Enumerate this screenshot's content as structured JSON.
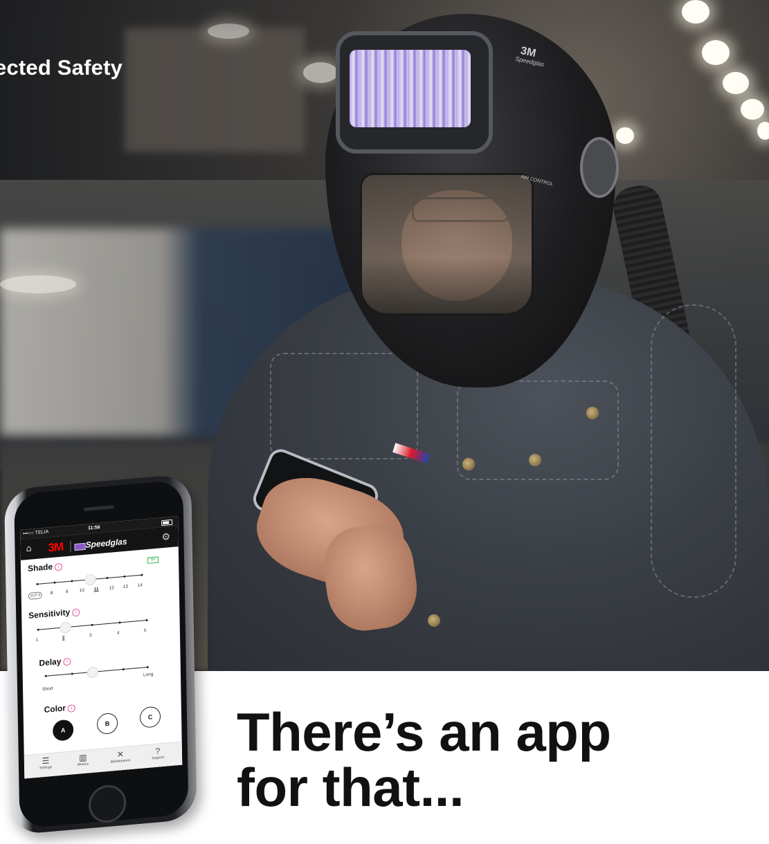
{
  "header": {
    "title": "ected Safety"
  },
  "photo": {
    "helmet_brand": "3M",
    "helmet_model_label": "Speedglas",
    "helmet_control_label": "AIR CONTROL"
  },
  "phone_app": {
    "status_bar": {
      "carrier": "•••○○ TELIA",
      "time": "11:56"
    },
    "nav": {
      "brand_logo": "3M",
      "product_logo": "Speedglas",
      "home_icon": "home-icon",
      "settings_icon": "gear-icon"
    },
    "ok_badge": "OK",
    "shade": {
      "title": "Shade",
      "cut_label": "CUT 5",
      "ticks": [
        "8",
        "9",
        "10",
        "11",
        "12",
        "13",
        "14"
      ],
      "selected": "11"
    },
    "sensitivity": {
      "title": "Sensitivity",
      "ticks": [
        "1",
        "2",
        "3",
        "4",
        "5"
      ],
      "selected": "2"
    },
    "delay": {
      "title": "Delay",
      "min_label": "Short",
      "max_label": "Long",
      "level": 0.45
    },
    "color": {
      "title": "Color",
      "options": [
        "A",
        "B",
        "C"
      ],
      "selected": "A"
    },
    "tabs": [
      {
        "label": "Settings",
        "icon": "sliders-icon"
      },
      {
        "label": "Metrics",
        "icon": "bar-chart-icon"
      },
      {
        "label": "Maintenance",
        "icon": "tools-icon"
      },
      {
        "label": "Support",
        "icon": "help-icon"
      }
    ]
  },
  "headline": {
    "line1": "There’s an app",
    "line2": "for that..."
  },
  "colors": {
    "headline": "#111111",
    "brand_red": "#ff0000",
    "speedglas_purple": "#8a58c9",
    "info_pink": "#e0559a"
  }
}
